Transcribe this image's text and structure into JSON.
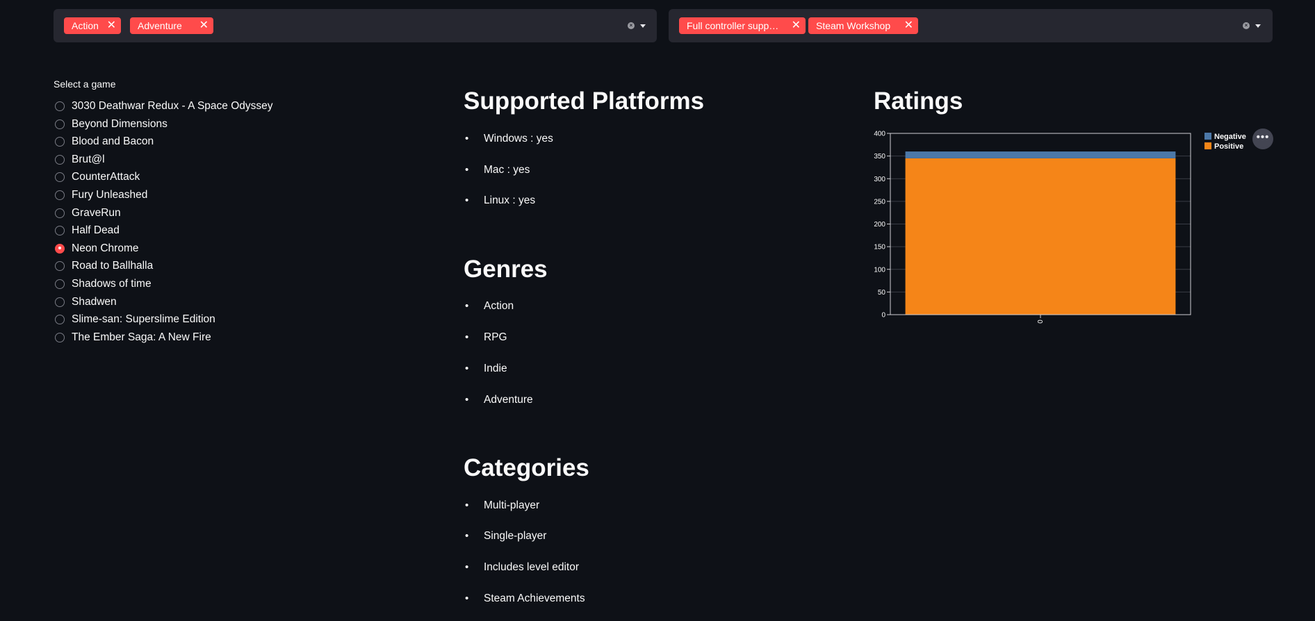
{
  "genre_filter": {
    "tags": [
      "Action",
      "Adventure"
    ],
    "remove_glyph": "✕",
    "clear_glyph": "×"
  },
  "category_filter": {
    "tags": [
      "Full controller supp…",
      "Steam Workshop"
    ],
    "remove_glyph": "✕",
    "clear_glyph": "×"
  },
  "game_select": {
    "label": "Select a game",
    "options": [
      "3030 Deathwar Redux - A Space Odyssey",
      "Beyond Dimensions",
      "Blood and Bacon",
      "Brut@l",
      "CounterAttack",
      "Fury Unleashed",
      "GraveRun",
      "Half Dead",
      "Neon Chrome",
      "Road to Ballhalla",
      "Shadows of time",
      "Shadwen",
      "Slime-san: Superslime Edition",
      "The Ember Saga: A New Fire"
    ],
    "selected": "Neon Chrome"
  },
  "platforms": {
    "title": "Supported Platforms",
    "items": [
      "Windows : yes",
      "Mac : yes",
      "Linux : yes"
    ]
  },
  "genres": {
    "title": "Genres",
    "items": [
      "Action",
      "RPG",
      "Indie",
      "Adventure"
    ]
  },
  "categories": {
    "title": "Categories",
    "items": [
      "Multi-player",
      "Single-player",
      "Includes level editor",
      "Steam Achievements"
    ]
  },
  "ratings": {
    "title": "Ratings",
    "menu_glyph": "•••"
  },
  "colors": {
    "accent": "#ff4b4b",
    "background": "#0e1117",
    "widget": "#262730",
    "negative": "#4c78a8",
    "positive": "#f58518"
  },
  "chart_data": {
    "type": "bar",
    "stacked": true,
    "categories": [
      "0"
    ],
    "series": [
      {
        "name": "Positive",
        "values": [
          345
        ]
      },
      {
        "name": "Negative",
        "values": [
          15
        ]
      }
    ],
    "legend": [
      "Negative",
      "Positive"
    ],
    "legend_position": "right",
    "ylim": [
      0,
      400
    ],
    "yticks": [
      0,
      50,
      100,
      150,
      200,
      250,
      300,
      350,
      400
    ],
    "grid": true,
    "title": "",
    "xlabel": "",
    "ylabel": ""
  }
}
